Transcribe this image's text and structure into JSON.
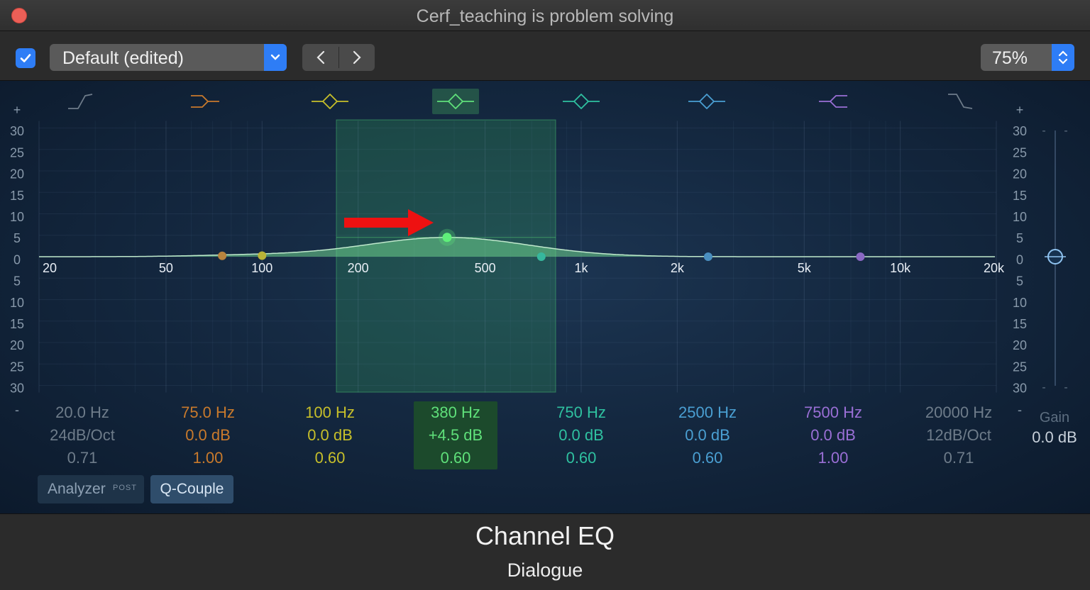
{
  "window": {
    "title": "Cerf_teaching is problem solving"
  },
  "toolbar": {
    "bypass_checked": true,
    "preset": "Default (edited)",
    "zoom": "75%"
  },
  "icons": {
    "close": "close-dot",
    "check": "checkmark-icon",
    "dropdown": "chevron-down-icon",
    "prev": "chevron-left-icon",
    "next": "chevron-right-icon",
    "stepper": "up-down-stepper-icon",
    "annotation": "red-arrow-icon"
  },
  "graph": {
    "db_labels_top": [
      "+",
      "30",
      "25",
      "20",
      "15",
      "10",
      "5",
      "0",
      "5",
      "10",
      "15",
      "20",
      "25",
      "30",
      "-"
    ],
    "freq_labels": [
      "20",
      "50",
      "100",
      "200",
      "500",
      "1k",
      "2k",
      "5k",
      "10k",
      "20k"
    ],
    "selected_band": 3
  },
  "bands": [
    {
      "freq": "20.0 Hz",
      "gain": "24dB/Oct",
      "q": "0.71",
      "color": "#6e7c8a",
      "shape": "low-cut"
    },
    {
      "freq": "75.0 Hz",
      "gain": "0.0 dB",
      "q": "1.00",
      "color": "#c97a2c",
      "shape": "low-shelf"
    },
    {
      "freq": "100 Hz",
      "gain": "0.0 dB",
      "q": "0.60",
      "color": "#c7bf2a",
      "shape": "bell"
    },
    {
      "freq": "380 Hz",
      "gain": "+4.5 dB",
      "q": "0.60",
      "color": "#4fd06a",
      "shape": "bell"
    },
    {
      "freq": "750 Hz",
      "gain": "0.0 dB",
      "q": "0.60",
      "color": "#2fc1a0",
      "shape": "bell"
    },
    {
      "freq": "2500 Hz",
      "gain": "0.0 dB",
      "q": "0.60",
      "color": "#4a9fd2",
      "shape": "bell"
    },
    {
      "freq": "7500 Hz",
      "gain": "0.0 dB",
      "q": "1.00",
      "color": "#9a6fd6",
      "shape": "high-shelf"
    },
    {
      "freq": "20000 Hz",
      "gain": "12dB/Oct",
      "q": "0.71",
      "color": "#6e7c8a",
      "shape": "high-cut"
    }
  ],
  "gain": {
    "label": "Gain",
    "value": "0.0 dB"
  },
  "buttons": {
    "analyzer": "Analyzer",
    "analyzer_post": "POST",
    "qcouple": "Q-Couple"
  },
  "footer": {
    "plugin": "Channel EQ",
    "track": "Dialogue"
  }
}
